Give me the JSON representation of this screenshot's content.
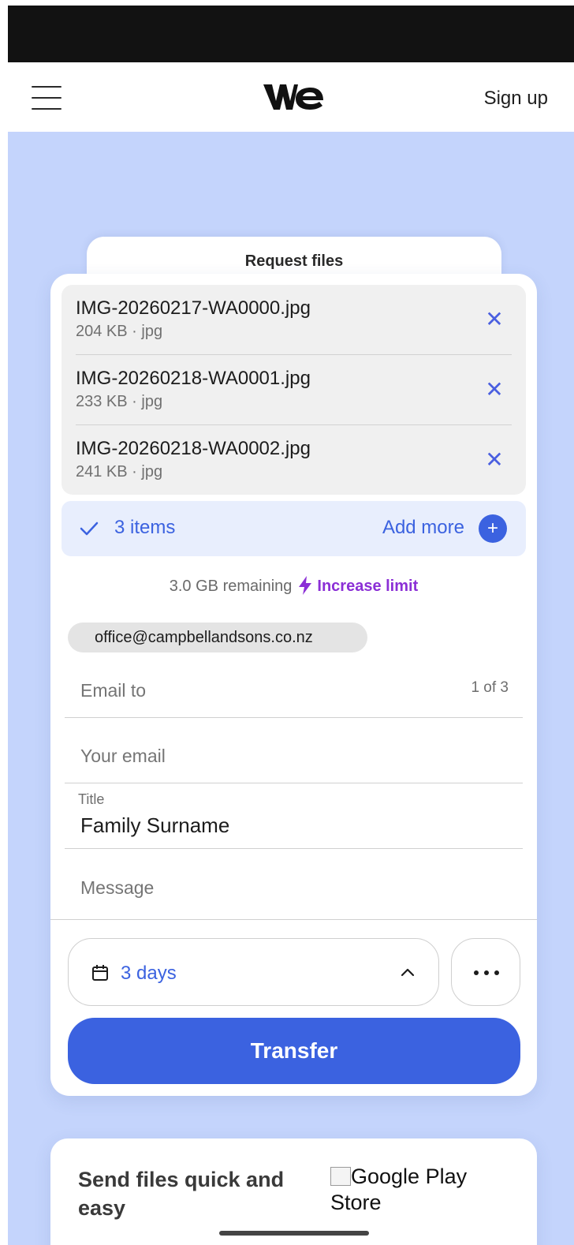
{
  "nav": {
    "menu_icon": "hamburger-menu-icon",
    "logo_icon": "wetransfer-we-logo",
    "signup_label": "Sign up"
  },
  "panel": {
    "tab_label": "Request files",
    "files": [
      {
        "name": "IMG-20260217-WA0000.jpg",
        "meta": "204 KB · jpg",
        "remove_icon": "close-icon"
      },
      {
        "name": "IMG-20260218-WA0001.jpg",
        "meta": "233 KB · jpg",
        "remove_icon": "close-icon"
      },
      {
        "name": "IMG-20260218-WA0002.jpg",
        "meta": "241 KB · jpg",
        "remove_icon": "close-icon"
      }
    ],
    "items_count": "3 items",
    "add_more_label": "Add more",
    "remaining": "3.0 GB remaining",
    "increase_label": "Increase limit",
    "recipient_chip": "office@campbellandsons.co.nz",
    "email_to": {
      "placeholder": "Email to",
      "counter": "1 of 3"
    },
    "your_email": {
      "placeholder": "Your email"
    },
    "title_field": {
      "label": "Title",
      "value": "Family Surname"
    },
    "message": {
      "placeholder": "Message"
    },
    "expiry_label": "3 days",
    "transfer_label": "Transfer"
  },
  "promo": {
    "text": "Send files quick and easy",
    "store_alt": "Google Play Store"
  },
  "colors": {
    "accent": "#3b62e0",
    "upgrade": "#8b2fd6",
    "background": "#c4d4fc"
  }
}
